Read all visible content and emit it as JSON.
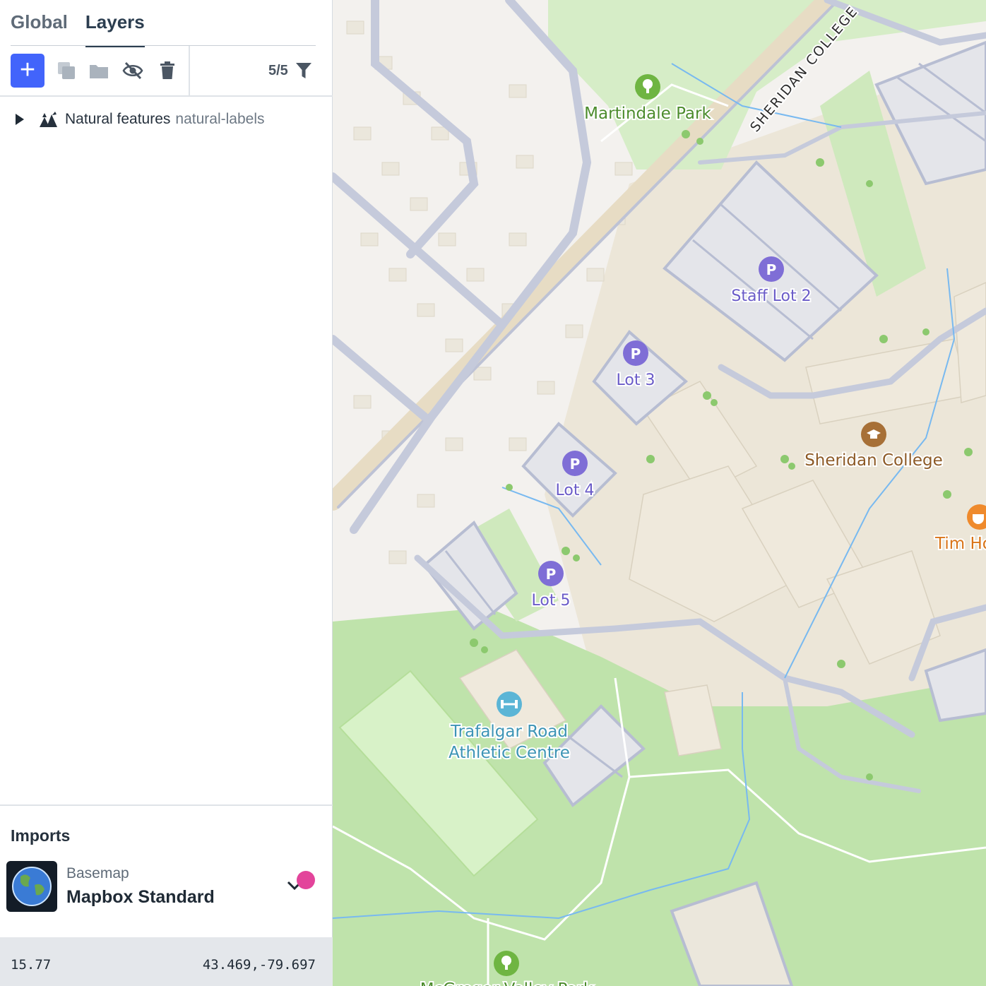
{
  "tabs": {
    "global": "Global",
    "layers": "Layers"
  },
  "toolbar": {
    "add": "+",
    "count": "5/5",
    "icons": [
      "duplicate-icon",
      "folder-icon",
      "hide-icon",
      "trash-icon",
      "filter-icon"
    ]
  },
  "layers": [
    {
      "name": "Natural features",
      "id": "natural-labels"
    }
  ],
  "imports": {
    "title": "Imports",
    "label": "Basemap",
    "name": "Mapbox Standard"
  },
  "status": {
    "zoom": "15.77",
    "coords": "43.469,-79.697"
  },
  "map": {
    "labels": {
      "martindale": "Martindale Park",
      "sheridan_road": "SHERIDAN COLLEGE",
      "staff_lot2": "Staff Lot 2",
      "lot3": "Lot 3",
      "lot4": "Lot 4",
      "lot5": "Lot 5",
      "college": "Sheridan College",
      "tim": "Tim Ho",
      "trafalgar1": "Trafalgar Road",
      "trafalgar2": "Athletic Centre",
      "mcgregor": "McGregor Valley Park"
    },
    "colors": {
      "park": "#6fb542",
      "parking": "#7f6ed6",
      "college": "#a77037",
      "food": "#ef8a2c",
      "sport": "#5bb5d6"
    }
  }
}
